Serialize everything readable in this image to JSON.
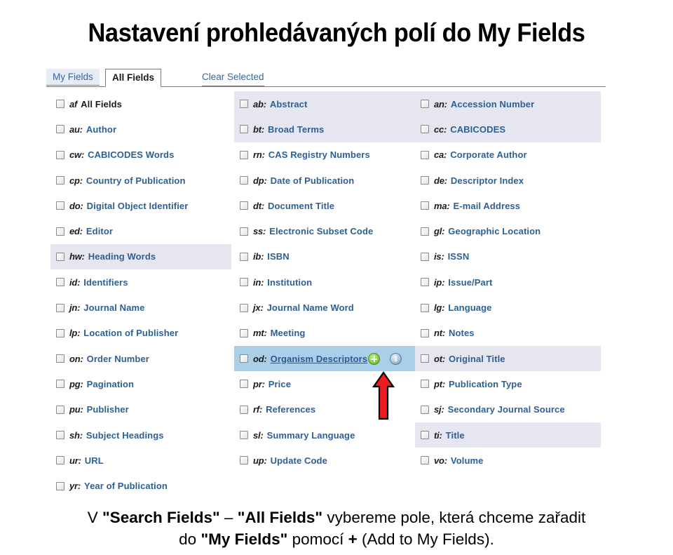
{
  "slide": {
    "title": "Nastavení prohledávaných polí do My Fields"
  },
  "tabs": {
    "my_fields": "My Fields",
    "all_fields": "All Fields",
    "clear_selected": "Clear Selected"
  },
  "icons": {
    "add_to_my_fields": "plus-circle-icon",
    "info": "info-circle-icon",
    "arrow": "red-arrow-up-annotation",
    "checkbox": "checkbox-icon"
  },
  "colors": {
    "link": "#2e6094",
    "tab_active_text": "#1a1a1a",
    "row_highlight": "#e6e6f0",
    "row_hover": "#aacfe8",
    "plus_green": "#6fbb31",
    "info_blue": "#7f9cba",
    "arrow_red": "#ee1c1c"
  },
  "columns": [
    {
      "id": "column-1",
      "rows": [
        {
          "code": "af",
          "label": "All Fields",
          "state": "normal",
          "dark": true
        },
        {
          "code": "au:",
          "label": "Author",
          "state": "normal"
        },
        {
          "code": "cw:",
          "label": "CABICODES Words",
          "state": "normal"
        },
        {
          "code": "cp:",
          "label": "Country of Publication",
          "state": "normal"
        },
        {
          "code": "do:",
          "label": "Digital Object Identifier",
          "state": "normal"
        },
        {
          "code": "ed:",
          "label": "Editor",
          "state": "normal"
        },
        {
          "code": "hw:",
          "label": "Heading Words",
          "state": "highlighted"
        },
        {
          "code": "id:",
          "label": "Identifiers",
          "state": "normal"
        },
        {
          "code": "jn:",
          "label": "Journal Name",
          "state": "normal"
        },
        {
          "code": "lp:",
          "label": "Location of Publisher",
          "state": "normal"
        },
        {
          "code": "on:",
          "label": "Order Number",
          "state": "normal"
        },
        {
          "code": "pg:",
          "label": "Pagination",
          "state": "normal"
        },
        {
          "code": "pu:",
          "label": "Publisher",
          "state": "normal"
        },
        {
          "code": "sh:",
          "label": "Subject Headings",
          "state": "normal"
        },
        {
          "code": "ur:",
          "label": "URL",
          "state": "normal"
        },
        {
          "code": "yr:",
          "label": "Year of Publication",
          "state": "normal"
        }
      ]
    },
    {
      "id": "column-2",
      "rows": [
        {
          "code": "ab:",
          "label": "Abstract",
          "state": "highlighted"
        },
        {
          "code": "bt:",
          "label": "Broad Terms",
          "state": "highlighted"
        },
        {
          "code": "rn:",
          "label": "CAS Registry Numbers",
          "state": "normal"
        },
        {
          "code": "dp:",
          "label": "Date of Publication",
          "state": "normal"
        },
        {
          "code": "dt:",
          "label": "Document Title",
          "state": "normal"
        },
        {
          "code": "ss:",
          "label": "Electronic Subset Code",
          "state": "normal"
        },
        {
          "code": "ib:",
          "label": "ISBN",
          "state": "normal"
        },
        {
          "code": "in:",
          "label": "Institution",
          "state": "normal"
        },
        {
          "code": "jx:",
          "label": "Journal Name Word",
          "state": "normal"
        },
        {
          "code": "mt:",
          "label": "Meeting",
          "state": "normal"
        },
        {
          "code": "od:",
          "label": "Organism Descriptors",
          "state": "hovered",
          "icons": true
        },
        {
          "code": "pr:",
          "label": "Price",
          "state": "normal"
        },
        {
          "code": "rf:",
          "label": "References",
          "state": "normal"
        },
        {
          "code": "sl:",
          "label": "Summary Language",
          "state": "normal"
        },
        {
          "code": "up:",
          "label": "Update Code",
          "state": "normal"
        }
      ]
    },
    {
      "id": "column-3",
      "rows": [
        {
          "code": "an:",
          "label": "Accession Number",
          "state": "highlighted"
        },
        {
          "code": "cc:",
          "label": "CABICODES",
          "state": "highlighted"
        },
        {
          "code": "ca:",
          "label": "Corporate Author",
          "state": "normal"
        },
        {
          "code": "de:",
          "label": "Descriptor Index",
          "state": "normal"
        },
        {
          "code": "ma:",
          "label": "E-mail Address",
          "state": "normal"
        },
        {
          "code": "gl:",
          "label": "Geographic Location",
          "state": "normal"
        },
        {
          "code": "is:",
          "label": "ISSN",
          "state": "normal"
        },
        {
          "code": "ip:",
          "label": "Issue/Part",
          "state": "normal"
        },
        {
          "code": "lg:",
          "label": "Language",
          "state": "normal"
        },
        {
          "code": "nt:",
          "label": "Notes",
          "state": "normal"
        },
        {
          "code": "ot:",
          "label": "Original Title",
          "state": "highlighted"
        },
        {
          "code": "pt:",
          "label": "Publication Type",
          "state": "normal"
        },
        {
          "code": "sj:",
          "label": "Secondary Journal Source",
          "state": "normal"
        },
        {
          "code": "ti:",
          "label": "Title",
          "state": "highlighted"
        },
        {
          "code": "vo:",
          "label": "Volume",
          "state": "normal"
        }
      ]
    }
  ],
  "caption": {
    "line1_parts": [
      {
        "text": "V ",
        "bold": false
      },
      {
        "text": "\"Search Fields\"",
        "bold": true
      },
      {
        "text": " – ",
        "bold": false
      },
      {
        "text": "\"All Fields\"",
        "bold": true
      },
      {
        "text": " vybereme pole, která chceme zařadit",
        "bold": false
      }
    ],
    "line2_parts": [
      {
        "text": "do ",
        "bold": false
      },
      {
        "text": "\"My Fields\"",
        "bold": true
      },
      {
        "text": " pomocí ",
        "bold": false
      },
      {
        "text": "+",
        "bold": true
      },
      {
        "text": " (Add to My Fields).",
        "bold": false
      }
    ]
  }
}
